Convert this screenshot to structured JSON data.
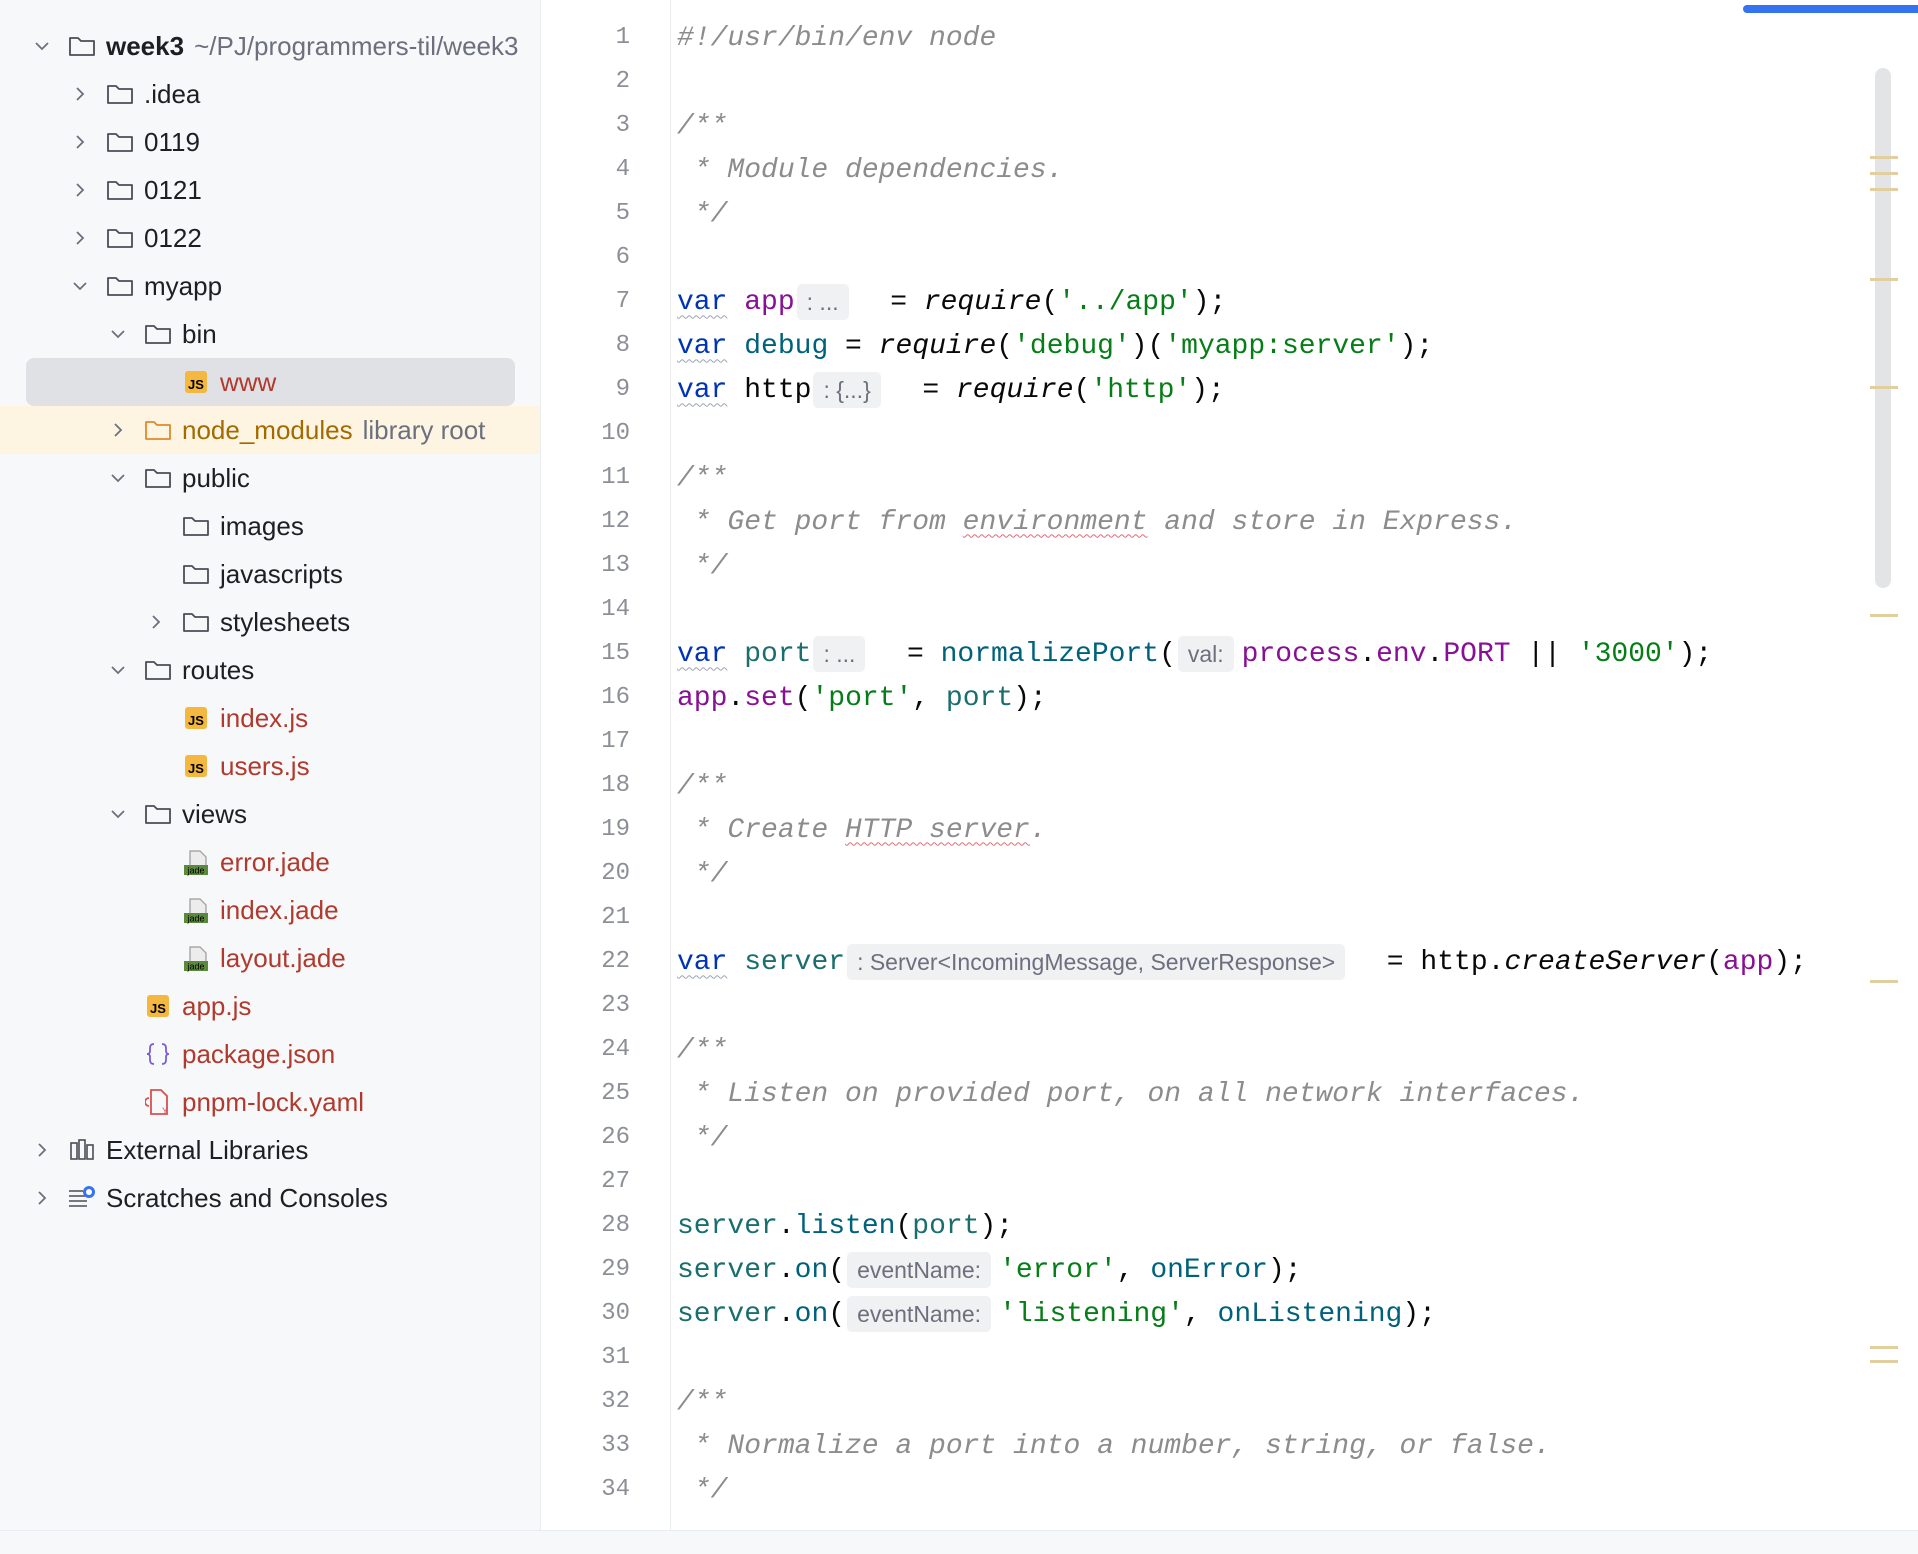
{
  "project_tree": {
    "items": [
      {
        "label": "week3",
        "hint": "~/PJ/programmers-til/week3",
        "depth": 0,
        "expander": "open",
        "icon": "folder",
        "style": "bold"
      },
      {
        "label": ".idea",
        "depth": 1,
        "expander": "closed",
        "icon": "folder"
      },
      {
        "label": "0119",
        "depth": 1,
        "expander": "closed",
        "icon": "folder"
      },
      {
        "label": "0121",
        "depth": 1,
        "expander": "closed",
        "icon": "folder"
      },
      {
        "label": "0122",
        "depth": 1,
        "expander": "closed",
        "icon": "folder"
      },
      {
        "label": "myapp",
        "depth": 1,
        "expander": "open",
        "icon": "folder"
      },
      {
        "label": "bin",
        "depth": 2,
        "expander": "open",
        "icon": "folder"
      },
      {
        "label": "www",
        "depth": 3,
        "icon": "js",
        "style": "red",
        "selected": true
      },
      {
        "label": "node_modules",
        "hint": "library root",
        "depth": 2,
        "expander": "closed",
        "icon": "folder-orange",
        "style": "orange",
        "library": true
      },
      {
        "label": "public",
        "depth": 2,
        "expander": "open",
        "icon": "folder"
      },
      {
        "label": "images",
        "depth": 3,
        "icon": "folder"
      },
      {
        "label": "javascripts",
        "depth": 3,
        "icon": "folder"
      },
      {
        "label": "stylesheets",
        "depth": 3,
        "expander": "closed",
        "icon": "folder"
      },
      {
        "label": "routes",
        "depth": 2,
        "expander": "open",
        "icon": "folder"
      },
      {
        "label": "index.js",
        "depth": 3,
        "icon": "js",
        "style": "red"
      },
      {
        "label": "users.js",
        "depth": 3,
        "icon": "js",
        "style": "red"
      },
      {
        "label": "views",
        "depth": 2,
        "expander": "open",
        "icon": "folder"
      },
      {
        "label": "error.jade",
        "depth": 3,
        "icon": "jade",
        "style": "red"
      },
      {
        "label": "index.jade",
        "depth": 3,
        "icon": "jade",
        "style": "red"
      },
      {
        "label": "layout.jade",
        "depth": 3,
        "icon": "jade",
        "style": "red"
      },
      {
        "label": "app.js",
        "depth": 2,
        "icon": "js",
        "style": "red"
      },
      {
        "label": "package.json",
        "depth": 2,
        "icon": "json",
        "style": "red"
      },
      {
        "label": "pnpm-lock.yaml",
        "depth": 2,
        "icon": "yaml",
        "style": "red"
      },
      {
        "label": "External Libraries",
        "depth": 0,
        "expander": "closed",
        "icon": "library"
      },
      {
        "label": "Scratches and Consoles",
        "depth": 0,
        "expander": "closed",
        "icon": "scratches"
      }
    ]
  },
  "inspections": {
    "warnings": "9",
    "typos": "2"
  },
  "editor": {
    "lines": [
      {
        "n": "1",
        "t": [
          [
            "cm",
            "#!/usr/bin/env node"
          ]
        ]
      },
      {
        "n": "2",
        "t": []
      },
      {
        "n": "3",
        "t": [
          [
            "cm",
            "/**"
          ]
        ]
      },
      {
        "n": "4",
        "t": [
          [
            "cm",
            " * Module dependencies."
          ]
        ]
      },
      {
        "n": "5",
        "t": [
          [
            "cm",
            " */"
          ]
        ]
      },
      {
        "n": "6",
        "t": []
      },
      {
        "n": "7",
        "t": [
          [
            "kw",
            "var"
          ],
          [
            "",
            "",
            " "
          ],
          [
            "vv",
            "app"
          ],
          [
            "chip",
            ": ..."
          ],
          [
            "",
            "  = "
          ],
          [
            "fn",
            "require"
          ],
          [
            "",
            "("
          ],
          [
            "st",
            "'../app'"
          ],
          [
            "",
            ");"
          ]
        ]
      },
      {
        "n": "8",
        "t": [
          [
            "kw",
            "var"
          ],
          [
            "",
            " "
          ],
          [
            "gl",
            "debug"
          ],
          [
            "",
            " = "
          ],
          [
            "fn",
            "require"
          ],
          [
            "",
            "("
          ],
          [
            "st",
            "'debug'"
          ],
          [
            "",
            ")("
          ],
          [
            "st",
            "'myapp:server'"
          ],
          [
            "",
            ");"
          ]
        ]
      },
      {
        "n": "9",
        "t": [
          [
            "kw",
            "var"
          ],
          [
            "",
            " http"
          ],
          [
            "chip",
            ": {...}"
          ],
          [
            "",
            "  = "
          ],
          [
            "fn",
            "require"
          ],
          [
            "",
            "("
          ],
          [
            "st",
            "'http'"
          ],
          [
            "",
            ");"
          ]
        ]
      },
      {
        "n": "10",
        "t": []
      },
      {
        "n": "11",
        "t": [
          [
            "cm",
            "/**"
          ]
        ]
      },
      {
        "n": "12",
        "t": [
          [
            "cm",
            " * Get port from "
          ],
          [
            "cmw",
            "environment"
          ],
          [
            "cm",
            " and store in Express."
          ]
        ]
      },
      {
        "n": "13",
        "t": [
          [
            "cm",
            " */"
          ]
        ]
      },
      {
        "n": "14",
        "t": []
      },
      {
        "n": "15",
        "t": [
          [
            "kw",
            "var"
          ],
          [
            "",
            " "
          ],
          [
            "lv",
            "port"
          ],
          [
            "chip",
            ": ..."
          ],
          [
            "",
            "  = "
          ],
          [
            "gl",
            "normalizePort"
          ],
          [
            "",
            "("
          ],
          [
            "chip",
            "val:"
          ],
          [
            "vv",
            "process"
          ],
          [
            "",
            "."
          ],
          [
            "vv",
            "env"
          ],
          [
            "",
            "."
          ],
          [
            "vv",
            "PORT"
          ],
          [
            "",
            " || "
          ],
          [
            "st",
            "'3000'"
          ],
          [
            "",
            ");"
          ]
        ]
      },
      {
        "n": "16",
        "t": [
          [
            "vv",
            "app"
          ],
          [
            "",
            "."
          ],
          [
            "vv",
            "set"
          ],
          [
            "",
            "("
          ],
          [
            "st",
            "'port'"
          ],
          [
            "",
            ", "
          ],
          [
            "lv",
            "port"
          ],
          [
            "",
            ");"
          ]
        ]
      },
      {
        "n": "17",
        "t": []
      },
      {
        "n": "18",
        "t": [
          [
            "cm",
            "/**"
          ]
        ]
      },
      {
        "n": "19",
        "t": [
          [
            "cm",
            " * Create "
          ],
          [
            "cmw",
            "HTTP server"
          ],
          [
            "cm",
            "."
          ]
        ]
      },
      {
        "n": "20",
        "t": [
          [
            "cm",
            " */"
          ]
        ]
      },
      {
        "n": "21",
        "t": []
      },
      {
        "n": "22",
        "t": [
          [
            "kw",
            "var"
          ],
          [
            "",
            " "
          ],
          [
            "lv",
            "server"
          ],
          [
            "chip",
            ": Server<IncomingMessage, ServerResponse>"
          ],
          [
            "",
            "  = http."
          ],
          [
            "fn",
            "createServer"
          ],
          [
            "",
            "("
          ],
          [
            "vv",
            "app"
          ],
          [
            "",
            ");"
          ]
        ]
      },
      {
        "n": "23",
        "t": []
      },
      {
        "n": "24",
        "t": [
          [
            "cm",
            "/**"
          ]
        ]
      },
      {
        "n": "25",
        "t": [
          [
            "cm",
            " * Listen on provided port, on all network interfaces."
          ]
        ]
      },
      {
        "n": "26",
        "t": [
          [
            "cm",
            " */"
          ]
        ]
      },
      {
        "n": "27",
        "t": []
      },
      {
        "n": "28",
        "t": [
          [
            "lv",
            "server"
          ],
          [
            "",
            "."
          ],
          [
            "gl",
            "listen"
          ],
          [
            "",
            "("
          ],
          [
            "lv",
            "port"
          ],
          [
            "",
            ");"
          ]
        ]
      },
      {
        "n": "29",
        "t": [
          [
            "lv",
            "server"
          ],
          [
            "",
            "."
          ],
          [
            "gl",
            "on"
          ],
          [
            "",
            "("
          ],
          [
            "chip",
            "eventName:"
          ],
          [
            "st",
            "'error'"
          ],
          [
            "",
            ", "
          ],
          [
            "gl",
            "onError"
          ],
          [
            "",
            ");"
          ]
        ]
      },
      {
        "n": "30",
        "t": [
          [
            "lv",
            "server"
          ],
          [
            "",
            "."
          ],
          [
            "gl",
            "on"
          ],
          [
            "",
            "("
          ],
          [
            "chip",
            "eventName:"
          ],
          [
            "st",
            "'listening'"
          ],
          [
            "",
            ", "
          ],
          [
            "gl",
            "onListening"
          ],
          [
            "",
            ");"
          ]
        ]
      },
      {
        "n": "31",
        "t": []
      },
      {
        "n": "32",
        "t": [
          [
            "cm",
            "/**"
          ]
        ]
      },
      {
        "n": "33",
        "t": [
          [
            "cm",
            " * Normalize a port into a number, string, or false."
          ]
        ]
      },
      {
        "n": "34",
        "t": [
          [
            "cm",
            " */"
          ]
        ]
      }
    ]
  }
}
